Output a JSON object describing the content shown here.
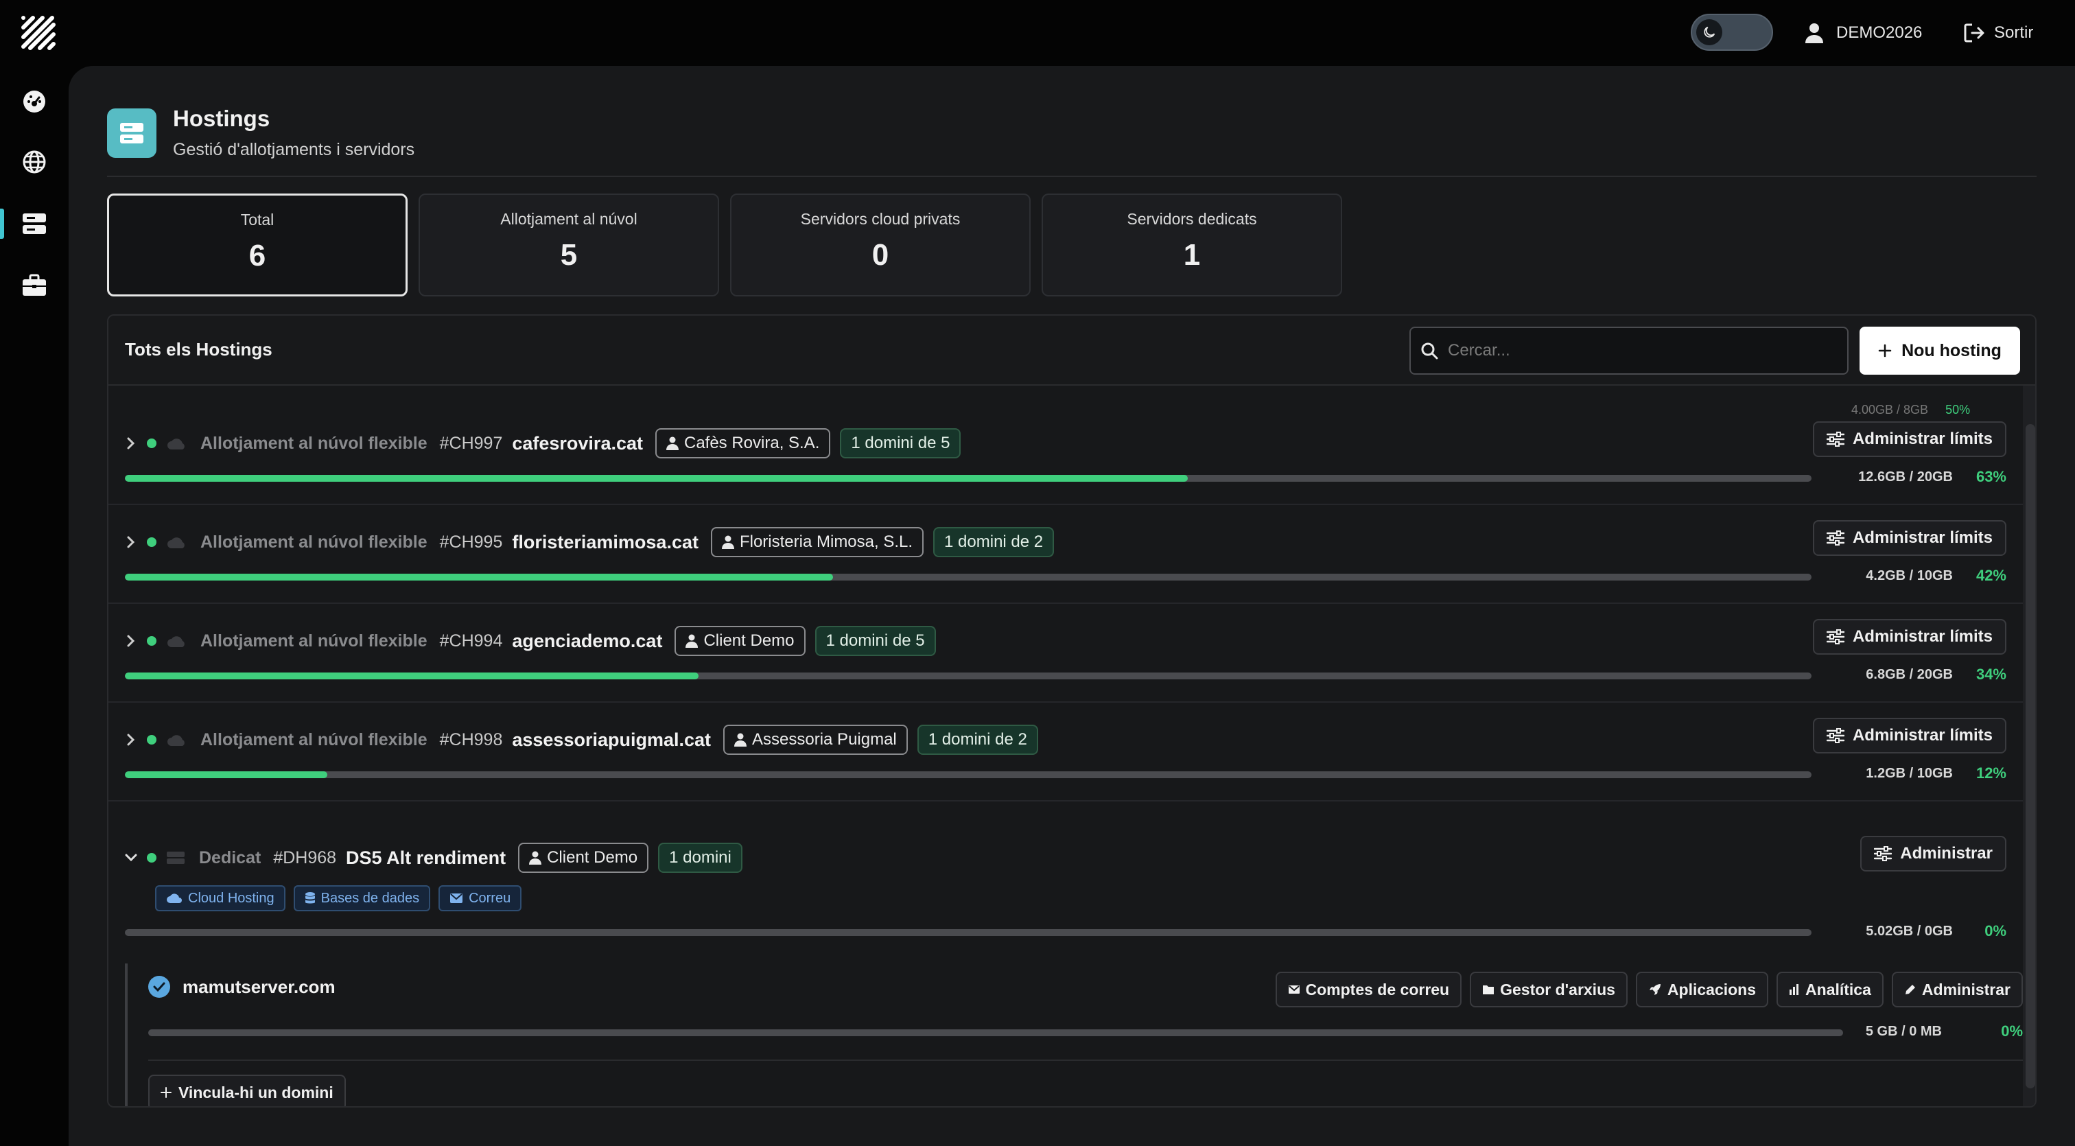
{
  "user": {
    "name": "DEMO2026",
    "logout_label": "Sortir"
  },
  "page": {
    "title": "Hostings",
    "subtitle": "Gestió d'allotjaments i servidors"
  },
  "stats": [
    {
      "label": "Total",
      "value": "6"
    },
    {
      "label": "Allotjament al núvol",
      "value": "5"
    },
    {
      "label": "Servidors cloud privats",
      "value": "0"
    },
    {
      "label": "Servidors dedicats",
      "value": "1"
    }
  ],
  "list": {
    "title": "Tots els Hostings",
    "search_placeholder": "Cercar...",
    "new_button": "Nou hosting",
    "clipped_usage": "4.00GB / 8GB",
    "clipped_pct": "50%"
  },
  "rows": [
    {
      "type": "Allotjament al núvol flexible",
      "id": "#CH997",
      "name": "cafesrovira.cat",
      "client": "Cafès Rovira, S.A.",
      "domains": "1 domini de 5",
      "button": "Administrar límits",
      "usage": "12.6GB / 20GB",
      "percent": "63%",
      "fill": 0.63
    },
    {
      "type": "Allotjament al núvol flexible",
      "id": "#CH995",
      "name": "floristeriamimosa.cat",
      "client": "Floristeria Mimosa, S.L.",
      "domains": "1 domini de 2",
      "button": "Administrar límits",
      "usage": "4.2GB / 10GB",
      "percent": "42%",
      "fill": 0.42
    },
    {
      "type": "Allotjament al núvol flexible",
      "id": "#CH994",
      "name": "agenciademo.cat",
      "client": "Client Demo",
      "domains": "1 domini de 5",
      "button": "Administrar límits",
      "usage": "6.8GB / 20GB",
      "percent": "34%",
      "fill": 0.34
    },
    {
      "type": "Allotjament al núvol flexible",
      "id": "#CH998",
      "name": "assessoriapuigmal.cat",
      "client": "Assessoria Puigmal",
      "domains": "1 domini de 2",
      "button": "Administrar límits",
      "usage": "1.2GB / 10GB",
      "percent": "12%",
      "fill": 0.12
    }
  ],
  "dedicated": {
    "type": "Dedicat",
    "id": "#DH968",
    "name": "DS5 Alt rendiment",
    "client": "Client Demo",
    "domains": "1 domini",
    "button": "Administrar",
    "tags": [
      "Cloud Hosting",
      "Bases de dades",
      "Correu"
    ],
    "usage": "5.02GB / 0GB",
    "percent": "0%",
    "fill": 0,
    "domain": {
      "name": "mamutserver.com",
      "buttons": [
        "Comptes de correu",
        "Gestor d'arxius",
        "Aplicacions",
        "Analítica",
        "Administrar"
      ],
      "usage": "5 GB / 0 MB",
      "percent": "0%",
      "fill": 0
    },
    "link_button": "Vincula-hi un domini"
  }
}
